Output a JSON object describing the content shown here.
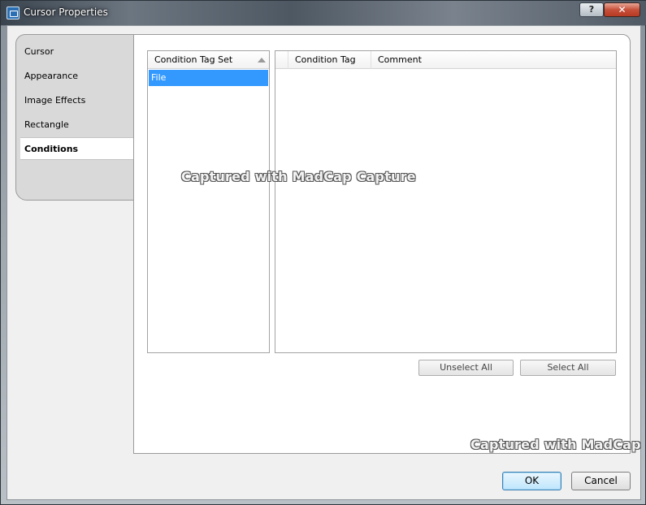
{
  "window": {
    "title": "Cursor Properties",
    "help_label": "?",
    "close_label": "✕"
  },
  "tabs": [
    {
      "label": "Cursor",
      "active": false
    },
    {
      "label": "Appearance",
      "active": false
    },
    {
      "label": "Image Effects",
      "active": false
    },
    {
      "label": "Rectangle",
      "active": false
    },
    {
      "label": "Conditions",
      "active": true
    }
  ],
  "left_list": {
    "header": "Condition Tag Set",
    "rows": [
      "File"
    ]
  },
  "right_list": {
    "headers": [
      "Condition Tag",
      "Comment"
    ]
  },
  "buttons": {
    "unselect_all": "Unselect All",
    "select_all": "Select All",
    "ok": "OK",
    "cancel": "Cancel"
  },
  "watermarks": {
    "center": "Captured with MadCap Capture",
    "bottom": "Captured with MadCap"
  },
  "colors": {
    "selection": "#3399ff",
    "close_button": "#c7503a"
  }
}
